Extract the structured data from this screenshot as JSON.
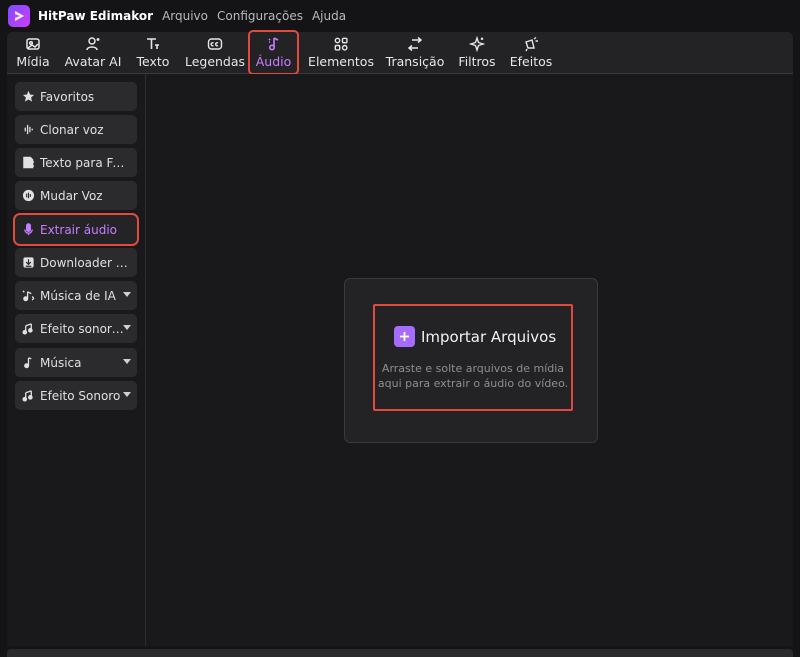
{
  "app": {
    "name": "HitPaw Edimakor",
    "menu": [
      "Arquivo",
      "Configurações",
      "Ajuda"
    ]
  },
  "toolbar": {
    "items": [
      {
        "label": "Mídia",
        "icon": "media-icon"
      },
      {
        "label": "Avatar AI",
        "icon": "avatar-icon"
      },
      {
        "label": "Texto",
        "icon": "text-icon"
      },
      {
        "label": "Legendas",
        "icon": "captions-icon"
      },
      {
        "label": "Áudio",
        "icon": "audio-icon",
        "active": true
      },
      {
        "label": "Elementos",
        "icon": "elements-icon"
      },
      {
        "label": "Transição",
        "icon": "transition-icon"
      },
      {
        "label": "Filtros",
        "icon": "filters-icon"
      },
      {
        "label": "Efeitos",
        "icon": "effects-icon"
      }
    ]
  },
  "sidebar": {
    "items": [
      {
        "label": "Favoritos",
        "icon": "star-icon"
      },
      {
        "label": "Clonar voz",
        "icon": "waveform-icon"
      },
      {
        "label": "Texto para Fala",
        "icon": "text-to-speech-icon"
      },
      {
        "label": "Mudar Voz",
        "icon": "voice-change-icon"
      },
      {
        "label": "Extrair áudio",
        "icon": "microphone-icon",
        "active": true
      },
      {
        "label": "Downloader de...",
        "icon": "download-icon"
      },
      {
        "label": "Música de IA",
        "icon": "ai-music-icon",
        "dropdown": true
      },
      {
        "label": "Efeito sonoro...",
        "icon": "sound-effect-ai-icon",
        "dropdown": true
      },
      {
        "label": "Música",
        "icon": "music-note-icon",
        "dropdown": true
      },
      {
        "label": "Efeito Sonoro",
        "icon": "sound-effect-icon",
        "dropdown": true
      }
    ]
  },
  "import": {
    "button_label": "Importar Arquivos",
    "hint_line1": "Arraste e solte arquivos de mídia",
    "hint_line2": "aqui para extrair o áudio do vídeo."
  },
  "colors": {
    "accent": "#c77dff",
    "highlight_border": "#e04a3f",
    "background": "#19191b"
  }
}
